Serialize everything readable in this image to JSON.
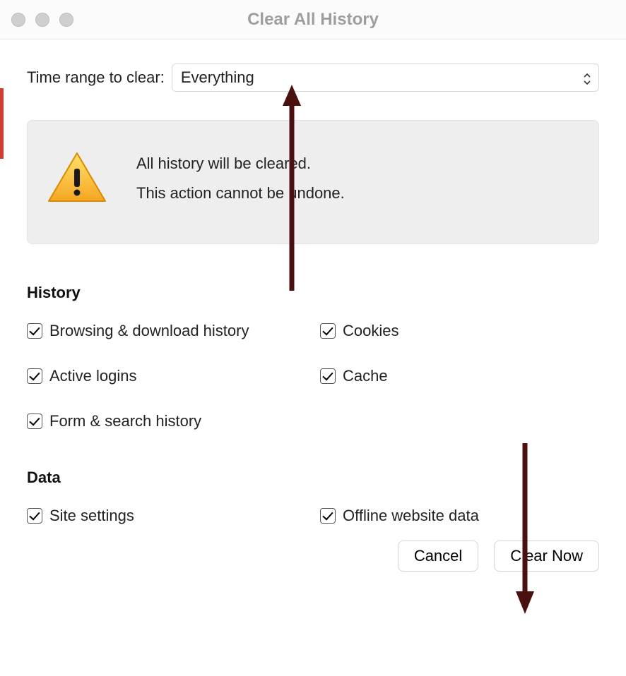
{
  "window": {
    "title": "Clear All History"
  },
  "range": {
    "label": "Time range to clear:",
    "value": "Everything"
  },
  "warning": {
    "line1": "All history will be cleared.",
    "line2": "This action cannot be undone."
  },
  "sections": {
    "history": {
      "title": "History",
      "items": [
        {
          "label": "Browsing & download history",
          "checked": true
        },
        {
          "label": "Cookies",
          "checked": true
        },
        {
          "label": "Active logins",
          "checked": true
        },
        {
          "label": "Cache",
          "checked": true
        },
        {
          "label": "Form & search history",
          "checked": true
        }
      ]
    },
    "data": {
      "title": "Data",
      "items": [
        {
          "label": "Site settings",
          "checked": true
        },
        {
          "label": "Offline website data",
          "checked": true
        }
      ]
    }
  },
  "buttons": {
    "cancel": "Cancel",
    "clear_now": "Clear Now"
  },
  "annotations": {
    "arrow_up": true,
    "arrow_down": true
  }
}
